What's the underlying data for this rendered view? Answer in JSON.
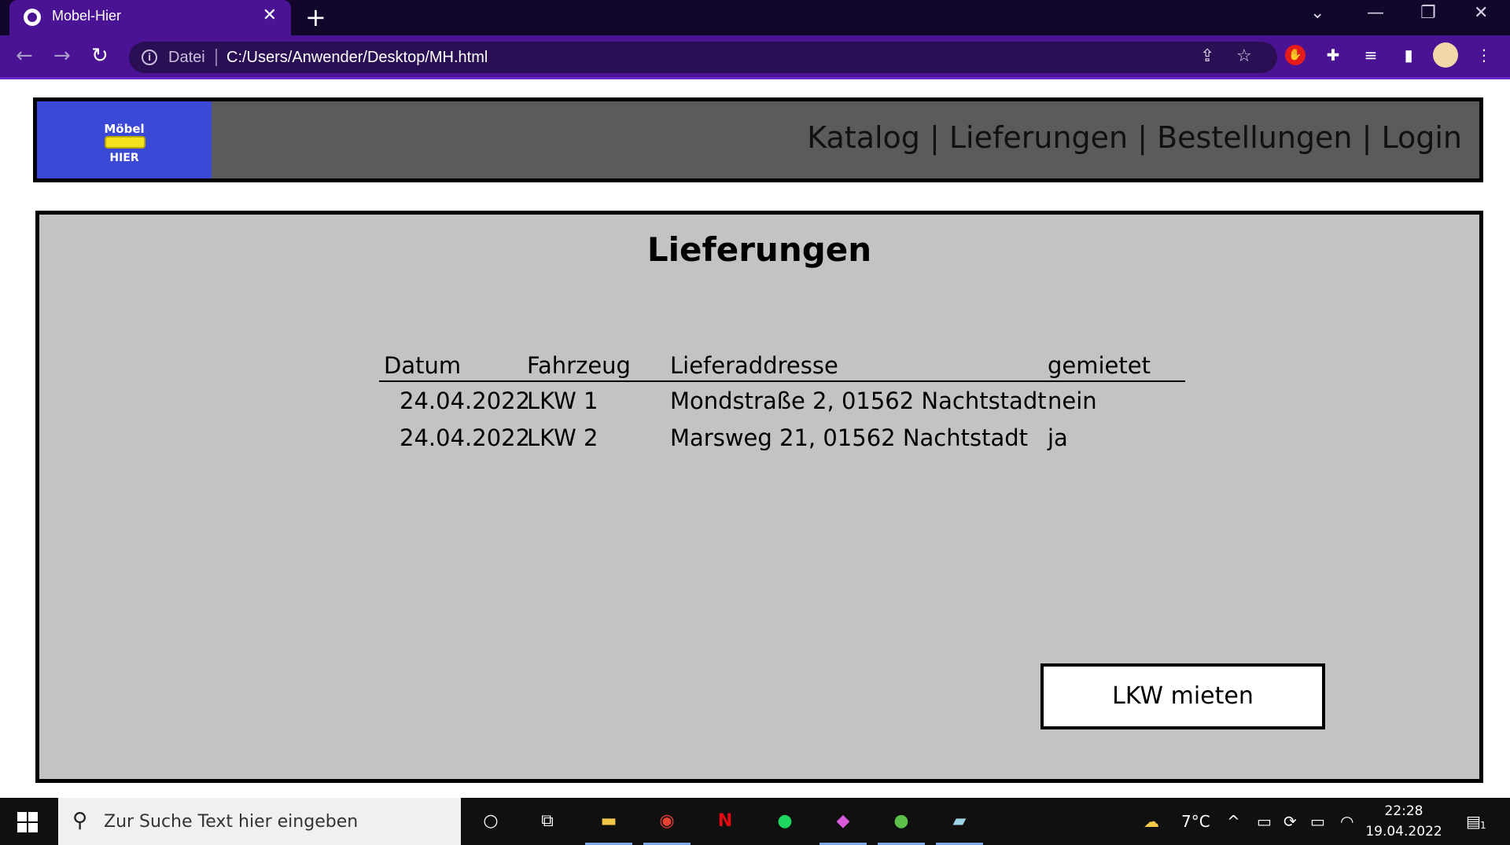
{
  "browser": {
    "tab_title": "Mobel-Hier",
    "tab_close": "✕",
    "new_tab": "+",
    "address_scheme": "Datei",
    "address_url": "C:/Users/Anwender/Desktop/MH.html",
    "icons": [
      "back-icon",
      "forward-icon",
      "reload-icon",
      "info-icon",
      "share-icon",
      "star-icon",
      "extension-icon",
      "puzzle-icon",
      "media-icon",
      "sidepanel-icon",
      "avatar",
      "menu-icon"
    ]
  },
  "header": {
    "logo_top": "Möbel",
    "logo_bottom": "HIER",
    "nav": [
      "Katalog",
      "Lieferungen",
      "Bestellungen",
      "Login"
    ],
    "separator": " | "
  },
  "main": {
    "title": "Lieferungen",
    "columns": [
      "Datum",
      "Fahrzeug",
      "Lieferaddresse",
      "gemietet"
    ],
    "rows": [
      [
        "24.04.2022",
        "LKW 1",
        "Mondstraße 2, 01562 Nachtstadt",
        "nein"
      ],
      [
        "24.04.2022",
        "LKW 2",
        "Marsweg 21, 01562 Nachtstadt",
        "ja"
      ]
    ],
    "rent_button": "LKW mieten"
  },
  "taskbar": {
    "search_placeholder": "Zur Suche Text hier eingeben",
    "weather": "7°C",
    "time": "22:28",
    "date": "19.04.2022",
    "notification_count": "1"
  },
  "colors": {
    "chrome_purple": "#4a1394",
    "header_grey": "#5b5b5b",
    "logo_blue": "#3b4ad6",
    "main_grey": "#c3c3c3"
  }
}
